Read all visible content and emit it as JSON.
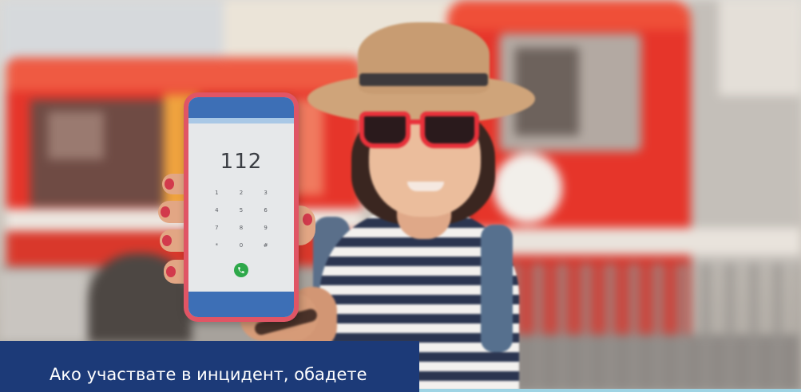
{
  "phone": {
    "dialed_number": "112",
    "keypad": [
      "1",
      "2",
      "3",
      "4",
      "5",
      "6",
      "7",
      "8",
      "9",
      "*",
      "0",
      "#"
    ],
    "call_icon": "phone-call-icon"
  },
  "caption": {
    "text": "Ако участвате в инцидент, обадете"
  },
  "colors": {
    "caption-bg": "#1c3a78",
    "caption-text": "#ffffff",
    "phone-case": "#e05565",
    "bars": "#3d6fb6",
    "call": "#2ea84a",
    "truck": "#e6352a",
    "glasses": "#e8313a",
    "accent-line": "#9fd4e4"
  }
}
